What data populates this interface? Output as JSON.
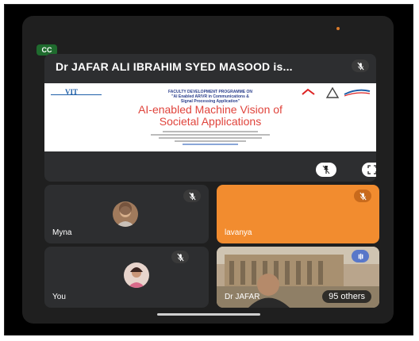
{
  "status": {
    "captions_badge": "CC"
  },
  "share": {
    "presenter_title": "Dr JAFAR ALI IBRAHIM SYED MASOOD is...",
    "slide": {
      "logo_left": "VIT",
      "program_line1": "FACULTY DEVELOPMENT PROGRAMME ON",
      "program_line2": "\"AI Enabled AR/VR in Communications &",
      "program_line3": "Signal Processing Application\"",
      "title_line1": "AI-enabled Machine Vision of",
      "title_line2": "Societal Applications"
    }
  },
  "participants": [
    {
      "name": "Myna",
      "tile_color": "#2d2e30"
    },
    {
      "name": "lavanya",
      "tile_color": "#f28c2f"
    },
    {
      "name": "You",
      "tile_color": "#2d2e30"
    },
    {
      "name": "Dr JAFAR",
      "tile_color": "#2d2e30"
    }
  ],
  "others_count_label": "95 others",
  "colors": {
    "background": "#1f1f1f",
    "tile": "#2d2e30",
    "accent_orange": "#f28c2f",
    "slide_title": "#e0443c"
  },
  "icons": [
    "mic-off-icon",
    "pin-icon",
    "fullscreen-icon",
    "audio-level-icon"
  ]
}
